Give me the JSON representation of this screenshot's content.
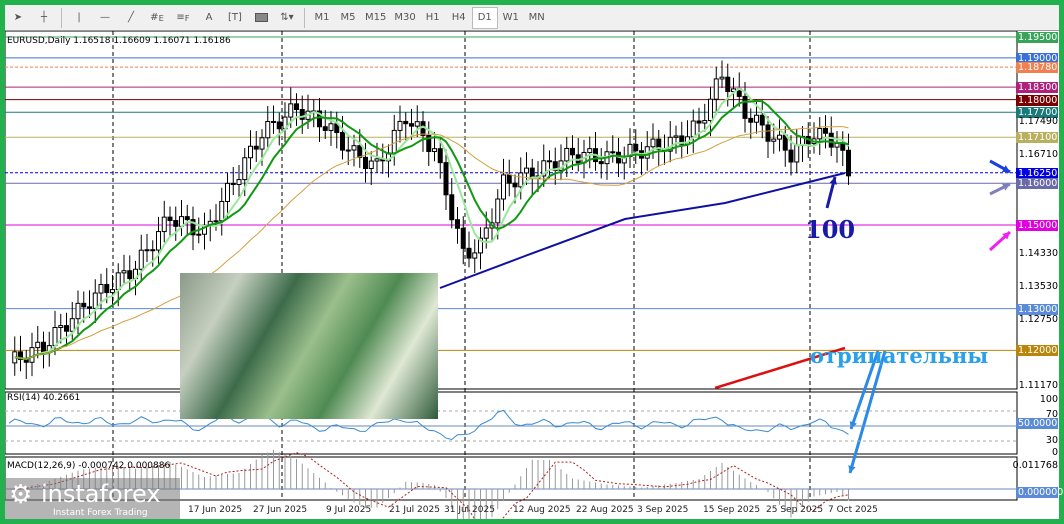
{
  "toolbar": {
    "tools": [
      "cursor-icon",
      "crosshair-icon",
      "vertical-line-icon",
      "horizontal-line-icon",
      "trendline-icon",
      "fibo-fan-icon",
      "fibo-levels-icon",
      "text-icon",
      "text-label-icon",
      "rectangle-icon",
      "arrows-icon"
    ],
    "text_tool": "A",
    "fibo_e": "E",
    "fibo_f": "F",
    "timeframes": [
      "M1",
      "M5",
      "M15",
      "M30",
      "H1",
      "H4",
      "D1",
      "W1",
      "MN"
    ],
    "active_timeframe": "D1"
  },
  "chart": {
    "header": "EURUSD,Daily  1.16518 1.16609 1.16071 1.16186",
    "price_axis": [
      "1.17490",
      "1.16710",
      "1.14330",
      "1.13530",
      "1.12750",
      "1.11170"
    ],
    "levels": [
      {
        "price": 1.195,
        "label": "1.19500",
        "color": "#3aa35a"
      },
      {
        "price": 1.19,
        "label": "1.19000",
        "color": "#3a6fd8"
      },
      {
        "price": 1.1878,
        "label": "1.18780",
        "color": "#f08050"
      },
      {
        "price": 1.183,
        "label": "1.18300",
        "color": "#b0207a"
      },
      {
        "price": 1.18,
        "label": "1.18000",
        "color": "#7a0000"
      },
      {
        "price": 1.177,
        "label": "1.17700",
        "color": "#1a7a7a"
      },
      {
        "price": 1.171,
        "label": "1.17100",
        "color": "#b8b060"
      },
      {
        "price": 1.1625,
        "label": "1.16250",
        "color": "#0000e0"
      },
      {
        "price": 1.16,
        "label": "1.16000",
        "color": "#6a6aaa"
      },
      {
        "price": 1.15,
        "label": "1.15000",
        "color": "#e000e0"
      },
      {
        "price": 1.13,
        "label": "1.13000",
        "color": "#5a8ad8"
      },
      {
        "price": 1.12,
        "label": "1.12000",
        "color": "#b8860b"
      }
    ],
    "price_keypoints": [
      [
        0,
        1.117
      ],
      [
        6,
        1.121
      ],
      [
        14,
        1.132
      ],
      [
        22,
        1.14
      ],
      [
        28,
        1.152
      ],
      [
        34,
        1.148
      ],
      [
        38,
        1.158
      ],
      [
        44,
        1.172
      ],
      [
        50,
        1.178
      ],
      [
        55,
        1.174
      ],
      [
        60,
        1.167
      ],
      [
        64,
        1.164
      ],
      [
        69,
        1.176
      ],
      [
        74,
        1.168
      ],
      [
        79,
        1.143
      ],
      [
        82,
        1.145
      ],
      [
        86,
        1.16
      ],
      [
        92,
        1.163
      ],
      [
        98,
        1.167
      ],
      [
        104,
        1.166
      ],
      [
        110,
        1.168
      ],
      [
        116,
        1.17
      ],
      [
        120,
        1.174
      ],
      [
        124,
        1.186
      ],
      [
        128,
        1.177
      ],
      [
        132,
        1.172
      ],
      [
        136,
        1.167
      ],
      [
        140,
        1.172
      ],
      [
        144,
        1.17
      ],
      [
        146,
        1.1618
      ]
    ],
    "annotation_100": "100",
    "annotation_negative": "отрицательны",
    "dates": [
      "17 Jun 2025",
      "27 Jun 2025",
      "9 Jul 2025",
      "21 Jul 2025",
      "31 Jul 2025",
      "12 Aug 2025",
      "22 Aug 2025",
      "3 Sep 2025",
      "15 Sep 2025",
      "25 Sep 2025",
      "7 Oct 2025"
    ]
  },
  "rsi": {
    "label": "RSI(14) 40.2661",
    "axis": [
      "100",
      "70",
      "30",
      "0"
    ],
    "tag": "50.0000"
  },
  "macd": {
    "label": "MACD(12,26,9) -0.000742 0.000886",
    "axis_top": "0.011768",
    "tag": "0.000000"
  },
  "logo": {
    "name": "instaforex",
    "tagline": "Instant Forex Trading"
  }
}
